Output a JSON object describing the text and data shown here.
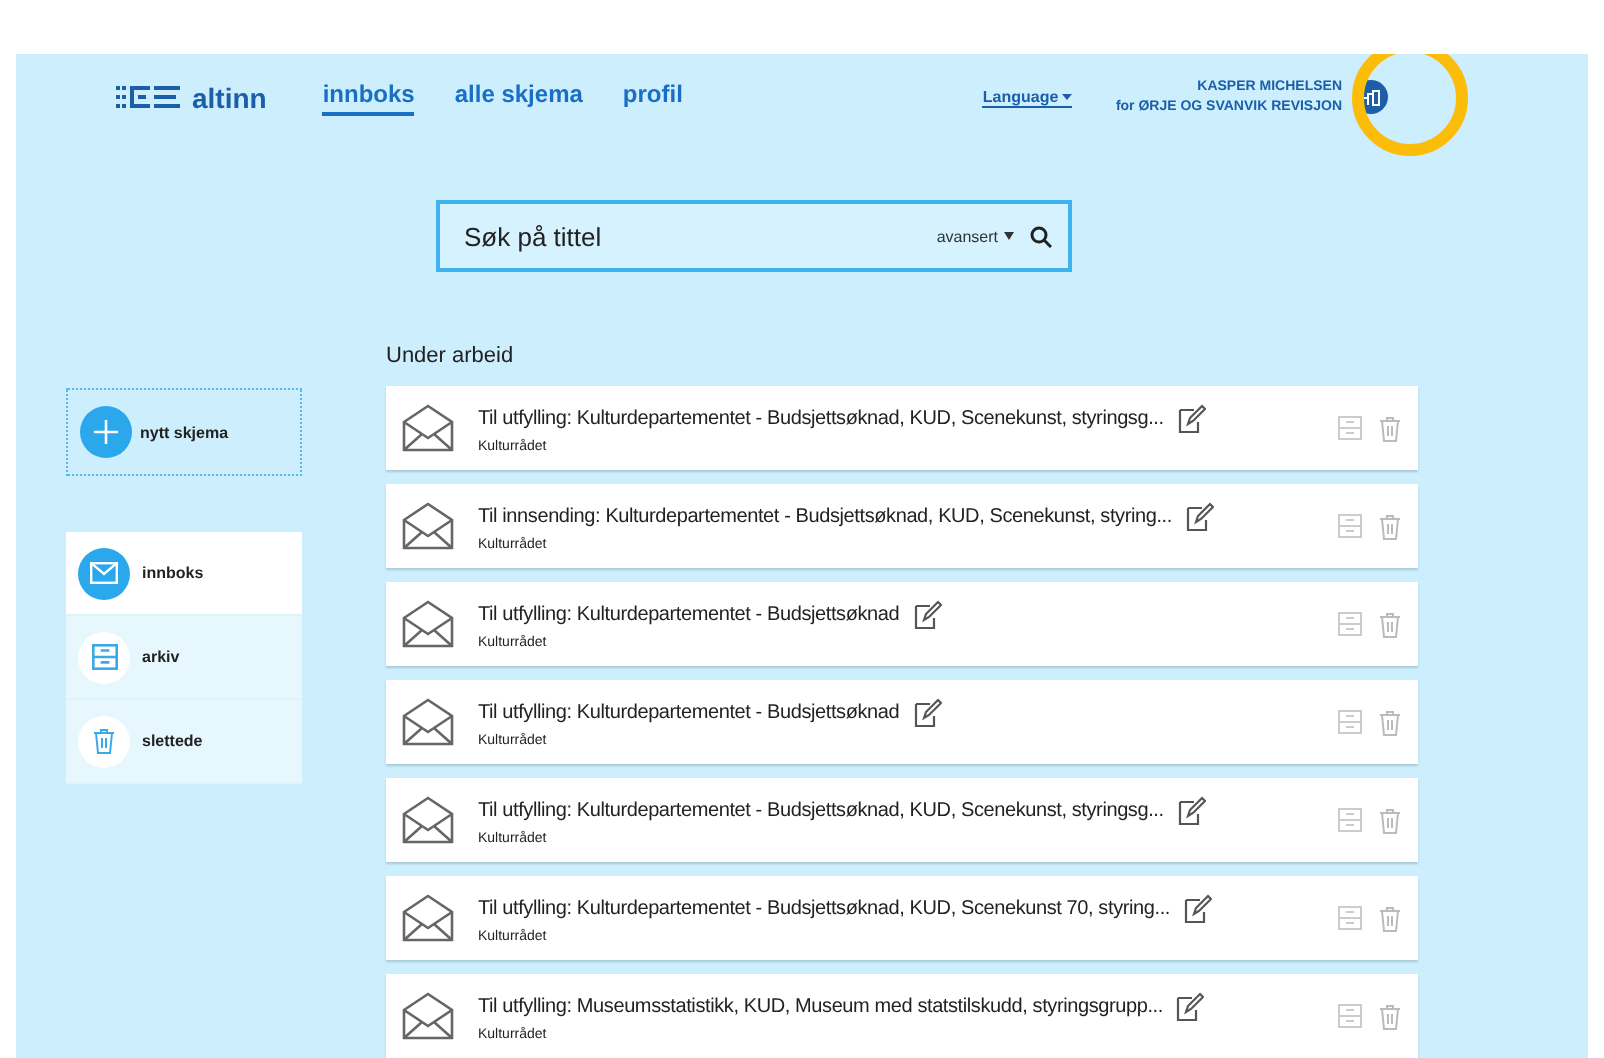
{
  "header": {
    "logo": "altinn",
    "nav": [
      {
        "label": "innboks",
        "selected": true
      },
      {
        "label": "alle skjema",
        "selected": false
      },
      {
        "label": "profil",
        "selected": false
      }
    ],
    "language": "Language",
    "user": {
      "name": "KASPER MICHELSEN",
      "org": "for ØRJE OG SVANVIK REVISJON"
    }
  },
  "search": {
    "placeholder": "Søk på tittel",
    "advanced": "avansert"
  },
  "sidebar": {
    "new_button": "nytt skjema",
    "items": [
      {
        "label": "innboks",
        "kind": "mail",
        "selected": true
      },
      {
        "label": "arkiv",
        "kind": "archive",
        "selected": false
      },
      {
        "label": "slettede",
        "kind": "trash",
        "selected": false
      }
    ]
  },
  "section_title": "Under arbeid",
  "messages": [
    {
      "title": "Til utfylling: Kulturdepartementet - Budsjettsøknad, KUD, Scenekunst, styringsg...",
      "sender": "Kulturrådet"
    },
    {
      "title": "Til innsending: Kulturdepartementet - Budsjettsøknad, KUD, Scenekunst, styring...",
      "sender": "Kulturrådet"
    },
    {
      "title": "Til utfylling: Kulturdepartementet - Budsjettsøknad",
      "sender": "Kulturrådet"
    },
    {
      "title": "Til utfylling: Kulturdepartementet - Budsjettsøknad",
      "sender": "Kulturrådet"
    },
    {
      "title": "Til utfylling: Kulturdepartementet - Budsjettsøknad, KUD, Scenekunst, styringsg...",
      "sender": "Kulturrådet"
    },
    {
      "title": "Til utfylling: Kulturdepartementet - Budsjettsøknad, KUD, Scenekunst 70, styring...",
      "sender": "Kulturrådet"
    },
    {
      "title": "Til utfylling: Museumsstatistikk, KUD, Museum med statstilskudd, styringsgrupp...",
      "sender": "Kulturrådet"
    }
  ]
}
